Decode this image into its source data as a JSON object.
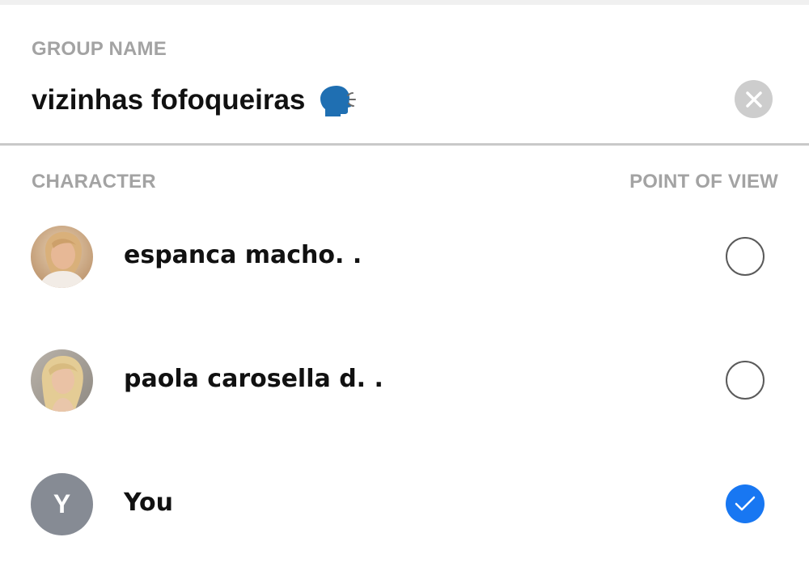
{
  "group": {
    "label": "GROUP NAME",
    "name_value": "vizinhas fofoqueiras",
    "name_icon": "speaking-head-icon",
    "clear_icon": "close-icon"
  },
  "list": {
    "character_header": "CHARACTER",
    "pov_header": "POINT OF VIEW",
    "items": [
      {
        "name": "espanca macho. .",
        "avatar": "photo",
        "selected": false
      },
      {
        "name": "paola carosella d. .",
        "avatar": "photo",
        "selected": false
      },
      {
        "name": "You",
        "avatar_letter": "Y",
        "selected": true
      }
    ]
  },
  "colors": {
    "accent": "#1877f2",
    "label_gray": "#a3a3a3",
    "avatar_gray": "#868b94",
    "clear_button_gray": "#cdcdcd"
  }
}
